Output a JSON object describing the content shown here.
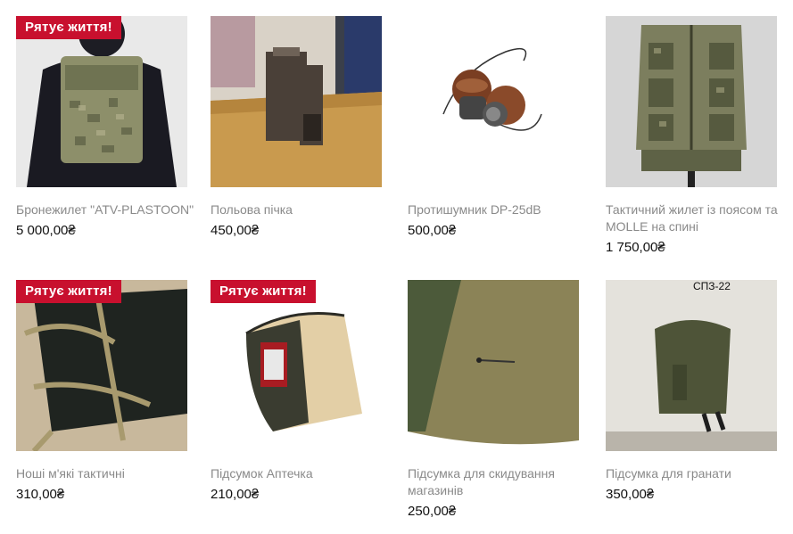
{
  "products": [
    {
      "title": "Бронежилет \"ATV-PLASTOON\"",
      "price": "5 000,00₴",
      "badge": "Рятує життя!"
    },
    {
      "title": "Польова пічка",
      "price": "450,00₴"
    },
    {
      "title": "Протишумник DP-25dB",
      "price": "500,00₴"
    },
    {
      "title": "Тактичний жилет із поясом та MOLLE на спині",
      "price": "1 750,00₴"
    },
    {
      "title": "Ноші м'які тактичні",
      "price": "310,00₴",
      "badge": "Рятує життя!"
    },
    {
      "title": "Підсумок Аптечка",
      "price": "210,00₴",
      "badge": "Рятує життя!"
    },
    {
      "title": "Підсумка для скидування магазинів",
      "price": "250,00₴"
    },
    {
      "title": "Підсумка для гранати",
      "price": "350,00₴",
      "image_label": "СПЗ-22"
    }
  ]
}
